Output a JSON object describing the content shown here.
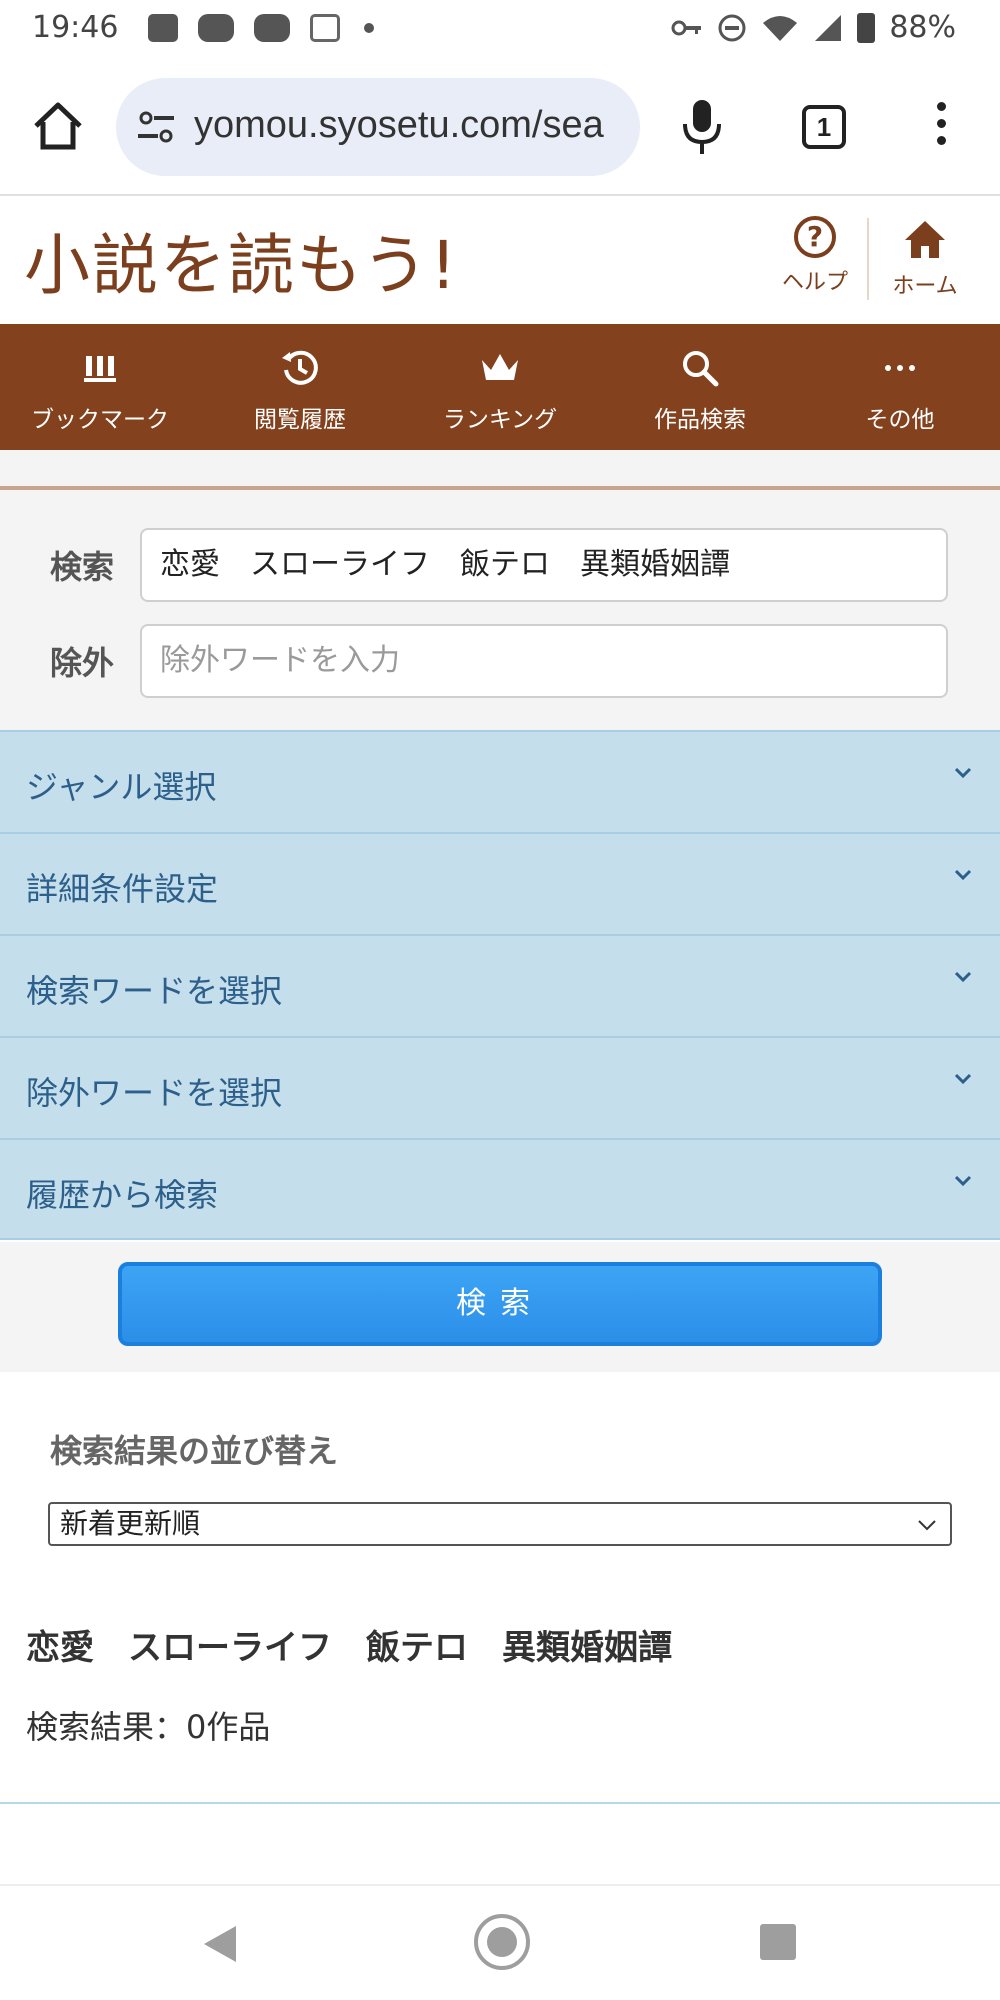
{
  "status_bar": {
    "time": "19:46",
    "battery_percent": "88%",
    "icons": [
      "image-icon",
      "youtube-icon",
      "youtube-icon",
      "d-icon",
      "dot-icon",
      "key-icon",
      "dnd-icon",
      "wifi-icon",
      "signal-icon",
      "battery-icon"
    ]
  },
  "browser": {
    "url": "yomou.syosetu.com/sea",
    "tab_count": "1",
    "icons": [
      "home-icon",
      "tune-icon",
      "mic-icon",
      "tabs-icon",
      "more-icon"
    ]
  },
  "site": {
    "logo_text": "小説を読もう!",
    "help_label": "ヘルプ",
    "help_glyph": "?",
    "home_label": "ホーム"
  },
  "nav": {
    "items": [
      {
        "label": "ブックマーク",
        "icon": "bookmark-icon"
      },
      {
        "label": "閲覧履歴",
        "icon": "history-icon"
      },
      {
        "label": "ランキング",
        "icon": "crown-icon"
      },
      {
        "label": "作品検索",
        "icon": "search-icon"
      },
      {
        "label": "その他",
        "icon": "more-icon"
      }
    ]
  },
  "search_form": {
    "keyword_label": "検索",
    "keyword_value": "恋愛　スローライフ　飯テロ　異類婚姻譚",
    "exclude_label": "除外",
    "exclude_placeholder": "除外ワードを入力"
  },
  "accordions": [
    {
      "label": "ジャンル選択"
    },
    {
      "label": "詳細条件設定"
    },
    {
      "label": "検索ワードを選択"
    },
    {
      "label": "除外ワードを選択"
    },
    {
      "label": "履歴から検索"
    }
  ],
  "search_button_label": "検索",
  "sort": {
    "title": "検索結果の並び替え",
    "selected": "新着更新順"
  },
  "results": {
    "query_heading": "恋愛　スローライフ　飯テロ　異類婚姻譚",
    "count_text": "検索結果：0作品"
  },
  "colors": {
    "brand_brown": "#83411e",
    "accordion_bg": "#c5deec",
    "accordion_text": "#2c5f8a",
    "button_blue": "#2b8fe8"
  }
}
